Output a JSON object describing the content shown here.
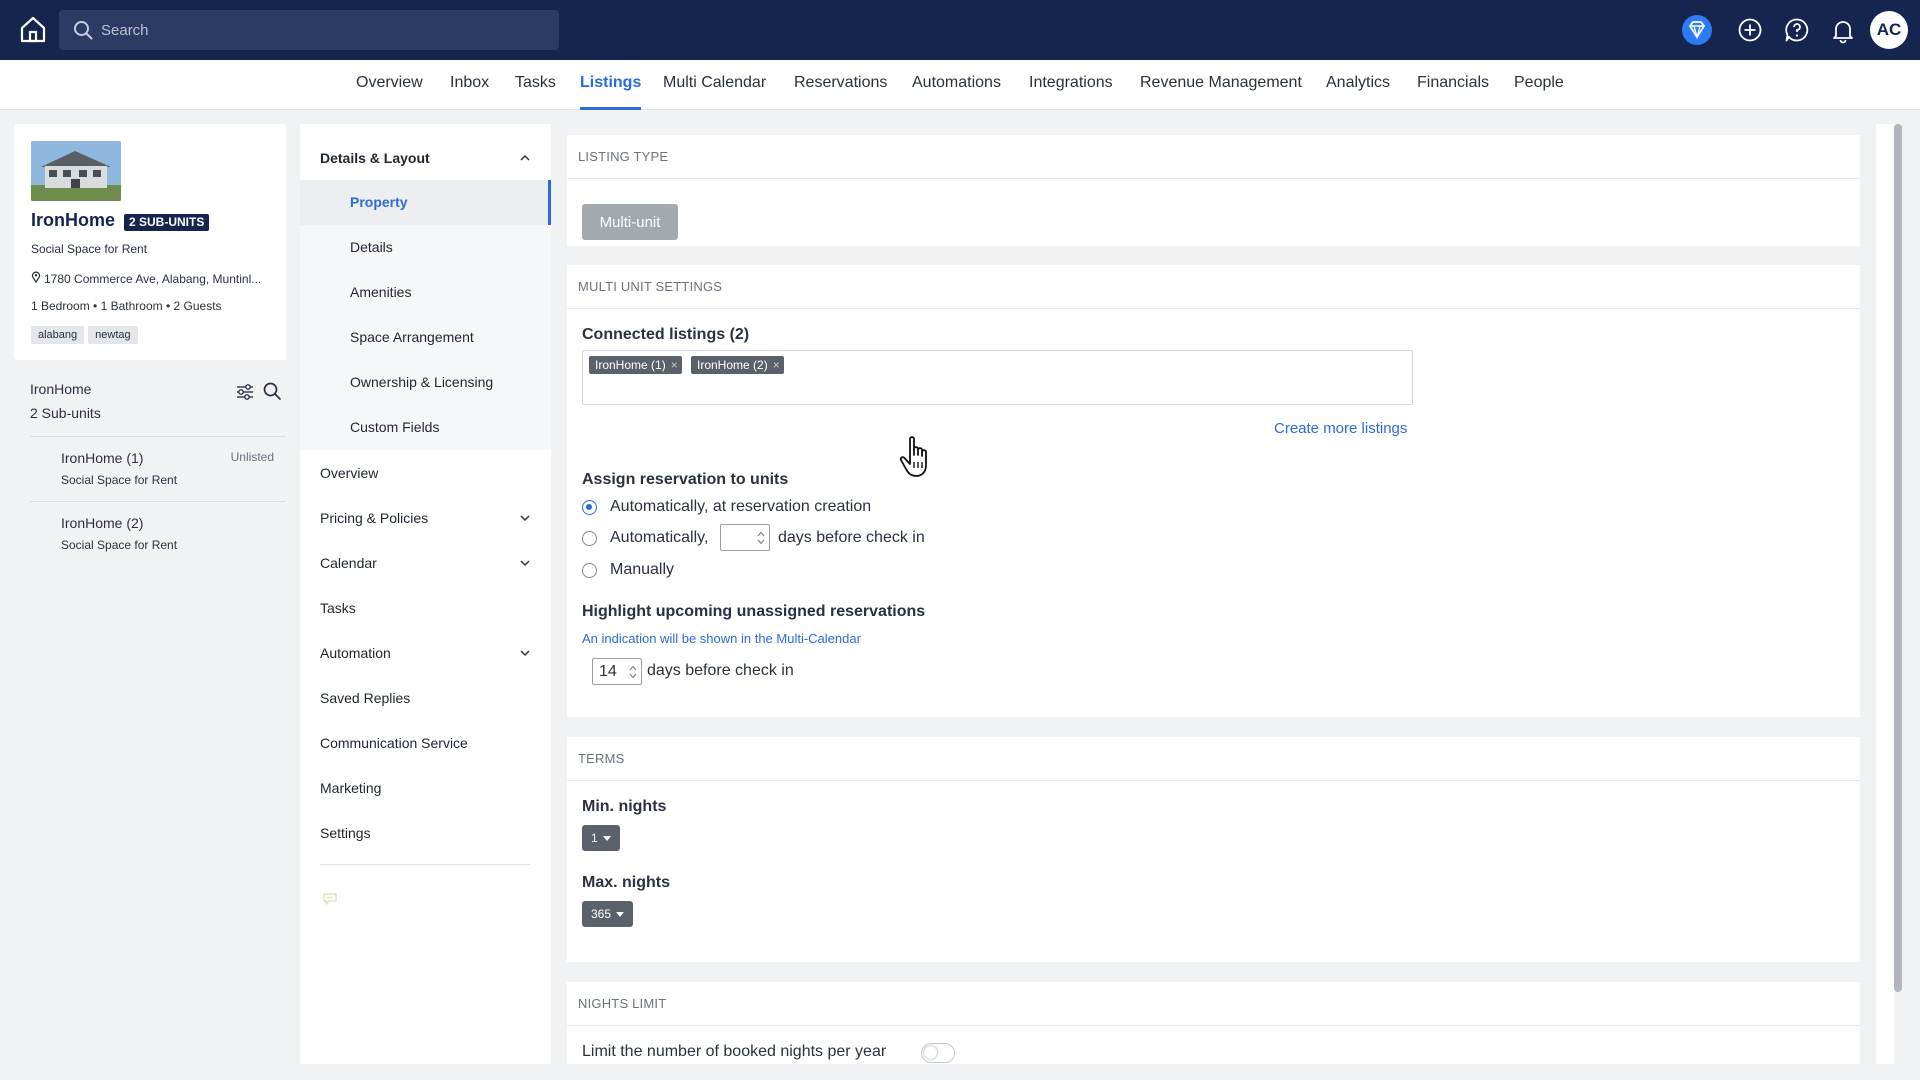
{
  "topbar": {
    "search_placeholder": "Search",
    "avatar_initials": "AC",
    "colors": {
      "bar": "#15254f",
      "accent": "#2b7bf2"
    }
  },
  "nav": {
    "items": [
      {
        "label": "Overview"
      },
      {
        "label": "Inbox"
      },
      {
        "label": "Tasks"
      },
      {
        "label": "Listings",
        "active": true
      },
      {
        "label": "Multi Calendar"
      },
      {
        "label": "Reservations"
      },
      {
        "label": "Automations"
      },
      {
        "label": "Integrations"
      },
      {
        "label": "Revenue Management"
      },
      {
        "label": "Analytics"
      },
      {
        "label": "Financials"
      },
      {
        "label": "People"
      }
    ]
  },
  "property": {
    "name": "IronHome",
    "badge": "2 SUB-UNITS",
    "type": "Social Space for Rent",
    "address": "1780 Commerce Ave, Alabang, Muntinl...",
    "bedrooms": "1 Bedroom",
    "bathrooms": "1 Bathroom",
    "guests": "2 Guests",
    "spec_separator": "•",
    "tags": [
      "alabang",
      "newtag"
    ]
  },
  "subunits": {
    "title": "IronHome",
    "count": "2 Sub-units",
    "items": [
      {
        "name": "IronHome (1)",
        "type": "Social Space for Rent",
        "status": "Unlisted"
      },
      {
        "name": "IronHome (2)",
        "type": "Social Space for Rent",
        "status": ""
      }
    ]
  },
  "section_nav": {
    "group_title": "Details & Layout",
    "group_items": [
      {
        "label": "Property",
        "active": true
      },
      {
        "label": "Details"
      },
      {
        "label": "Amenities"
      },
      {
        "label": "Space Arrangement"
      },
      {
        "label": "Ownership & Licensing"
      },
      {
        "label": "Custom Fields"
      }
    ],
    "items": [
      {
        "label": "Overview",
        "expandable": false
      },
      {
        "label": "Pricing & Policies",
        "expandable": true
      },
      {
        "label": "Calendar",
        "expandable": true
      },
      {
        "label": "Tasks",
        "expandable": false
      },
      {
        "label": "Automation",
        "expandable": true
      },
      {
        "label": "Saved Replies",
        "expandable": false
      },
      {
        "label": "Communication Service",
        "expandable": false
      },
      {
        "label": "Marketing",
        "expandable": false
      },
      {
        "label": "Settings",
        "expandable": false
      }
    ]
  },
  "listing_type": {
    "header": "LISTING TYPE",
    "button": "Multi-unit"
  },
  "multi_unit": {
    "header": "MULTI UNIT SETTINGS",
    "connected_label": "Connected listings (2)",
    "chips": [
      "IronHome (1)",
      "IronHome (2)"
    ],
    "chip_remove": "×",
    "create_more": "Create more listings",
    "assign_label": "Assign reservation to units",
    "radio_auto_creation": "Automatically, at reservation creation",
    "radio_auto_days_prefix": "Automatically,",
    "radio_auto_days_suffix": "days before check in",
    "radio_manual": "Manually",
    "selected_option": "auto_creation",
    "highlight_label": "Highlight upcoming unassigned reservations",
    "highlight_hint": "An indication will be shown in the Multi-Calendar",
    "highlight_days": "14",
    "highlight_suffix": "days before check in"
  },
  "terms": {
    "header": "TERMS",
    "min_label": "Min. nights",
    "min_value": "1",
    "max_label": "Max. nights",
    "max_value": "365"
  },
  "nights_limit": {
    "header": "NIGHTS LIMIT",
    "toggle_label": "Limit the number of booked nights per year",
    "enabled": false
  }
}
